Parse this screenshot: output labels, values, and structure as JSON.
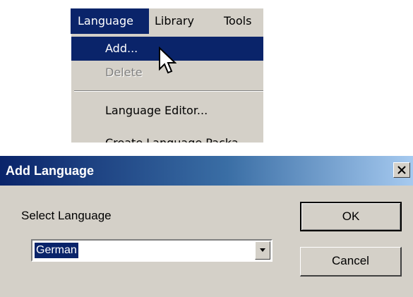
{
  "menubar": {
    "items": [
      {
        "label": "Language"
      },
      {
        "label": "Library"
      },
      {
        "label": "Tools"
      }
    ]
  },
  "menu": {
    "items": [
      {
        "label": "Add...",
        "state": "highlighted"
      },
      {
        "label": "Delete",
        "state": "disabled"
      },
      {
        "label": "Language Editor...",
        "state": "normal"
      },
      {
        "label": "Create Language Packa",
        "state": "normal"
      }
    ]
  },
  "dialog": {
    "title": "Add Language",
    "select_label": "Select Language",
    "selected_language": "German",
    "ok_label": "OK",
    "cancel_label": "Cancel"
  },
  "colors": {
    "face": "#d4d0c8",
    "highlight": "#0a246a",
    "title_gradient_end": "#a6caf0"
  }
}
